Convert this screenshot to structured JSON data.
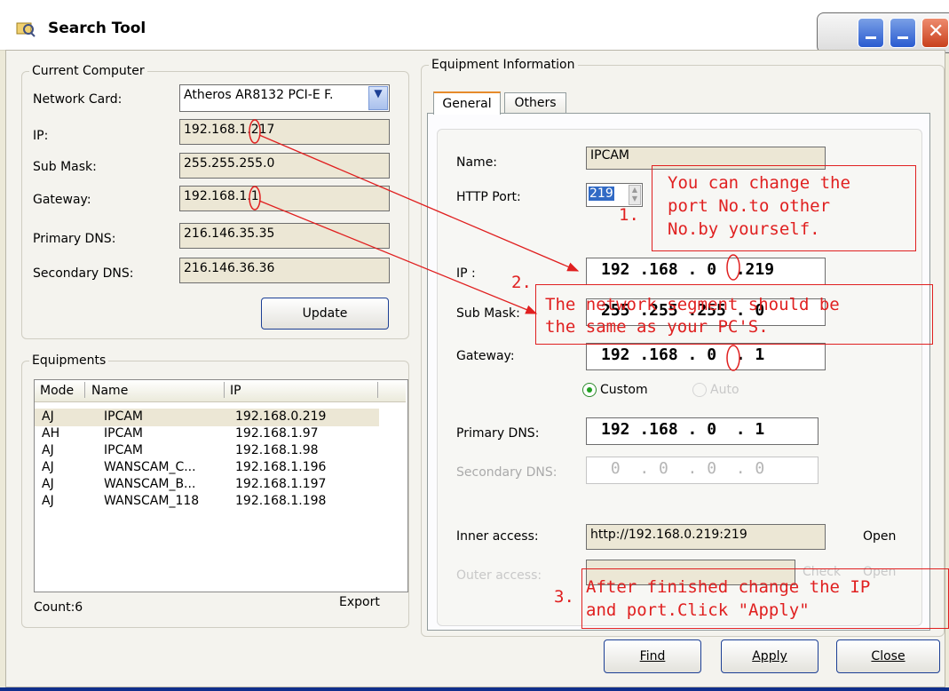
{
  "window": {
    "title": "Search Tool"
  },
  "current_computer": {
    "legend": "Current Computer",
    "network_card_label": "Network Card:",
    "network_card_value": "Atheros AR8132 PCI-E F.",
    "ip_label": "IP:",
    "ip_value": "192.168.1.217",
    "submask_label": "Sub Mask:",
    "submask_value": "255.255.255.0",
    "gateway_label": "Gateway:",
    "gateway_value": "192.168.1.1",
    "primary_dns_label": "Primary DNS:",
    "primary_dns_value": "216.146.35.35",
    "secondary_dns_label": "Secondary DNS:",
    "secondary_dns_value": "216.146.36.36",
    "update_label": "Update"
  },
  "equipments": {
    "legend": "Equipments",
    "columns": [
      "Mode",
      "Name",
      "IP"
    ],
    "rows": [
      {
        "mode": "AJ",
        "name": "IPCAM",
        "ip": "192.168.0.219",
        "selected": true
      },
      {
        "mode": "AH",
        "name": "IPCAM",
        "ip": "192.168.1.97"
      },
      {
        "mode": "AJ",
        "name": "IPCAM",
        "ip": "192.168.1.98"
      },
      {
        "mode": "AJ",
        "name": "WANSCAM_C...",
        "ip": "192.168.1.196"
      },
      {
        "mode": "AJ",
        "name": "WANSCAM_B...",
        "ip": "192.168.1.197"
      },
      {
        "mode": "AJ",
        "name": "WANSCAM_118",
        "ip": "192.168.1.198"
      }
    ],
    "count_label": "Count:6",
    "export_label": "Export"
  },
  "equipment_info": {
    "legend": "Equipment Information",
    "tabs": [
      "General",
      "Others"
    ],
    "name_label": "Name:",
    "name_value": "IPCAM",
    "http_port_label": "HTTP Port:",
    "http_port_value": "219",
    "ip_label": "IP :",
    "ip_value": "192 .168 . 0  .219",
    "submask_label": "Sub Mask:",
    "submask_value": "255 .255 .255 . 0",
    "gateway_label": "Gateway:",
    "gateway_value": "192 .168 . 0  . 1",
    "custom_label": "Custom",
    "auto_label": "Auto",
    "primary_dns_label": "Primary DNS:",
    "primary_dns_value": "192 .168 . 0  . 1",
    "secondary_dns_label": "Secondary DNS:",
    "secondary_dns_value": " 0  . 0  . 0  . 0",
    "inner_access_label": "Inner access:",
    "inner_access_value": "http://192.168.0.219:219",
    "open_label": "Open",
    "outer_access_label": "Outer access:",
    "check_label": "Check",
    "outer_open_label": "Open"
  },
  "annotations": {
    "note1_num": "1.",
    "note1_text": [
      "You can change the",
      "port No.to other",
      "No.by yourself."
    ],
    "note2_num": "2.",
    "note2_text": [
      "The network segment should be",
      "the same as your PC'S."
    ],
    "note3_num": "3.",
    "note3_text": [
      "After finished change the IP",
      "and port.Click \"Apply\""
    ]
  },
  "buttons": {
    "find": "Find",
    "apply": "Apply",
    "close": "Close"
  },
  "colors": {
    "annotation": "#e02020",
    "titlebar_close": "#c8401d",
    "button_border": "#1c3f95"
  }
}
